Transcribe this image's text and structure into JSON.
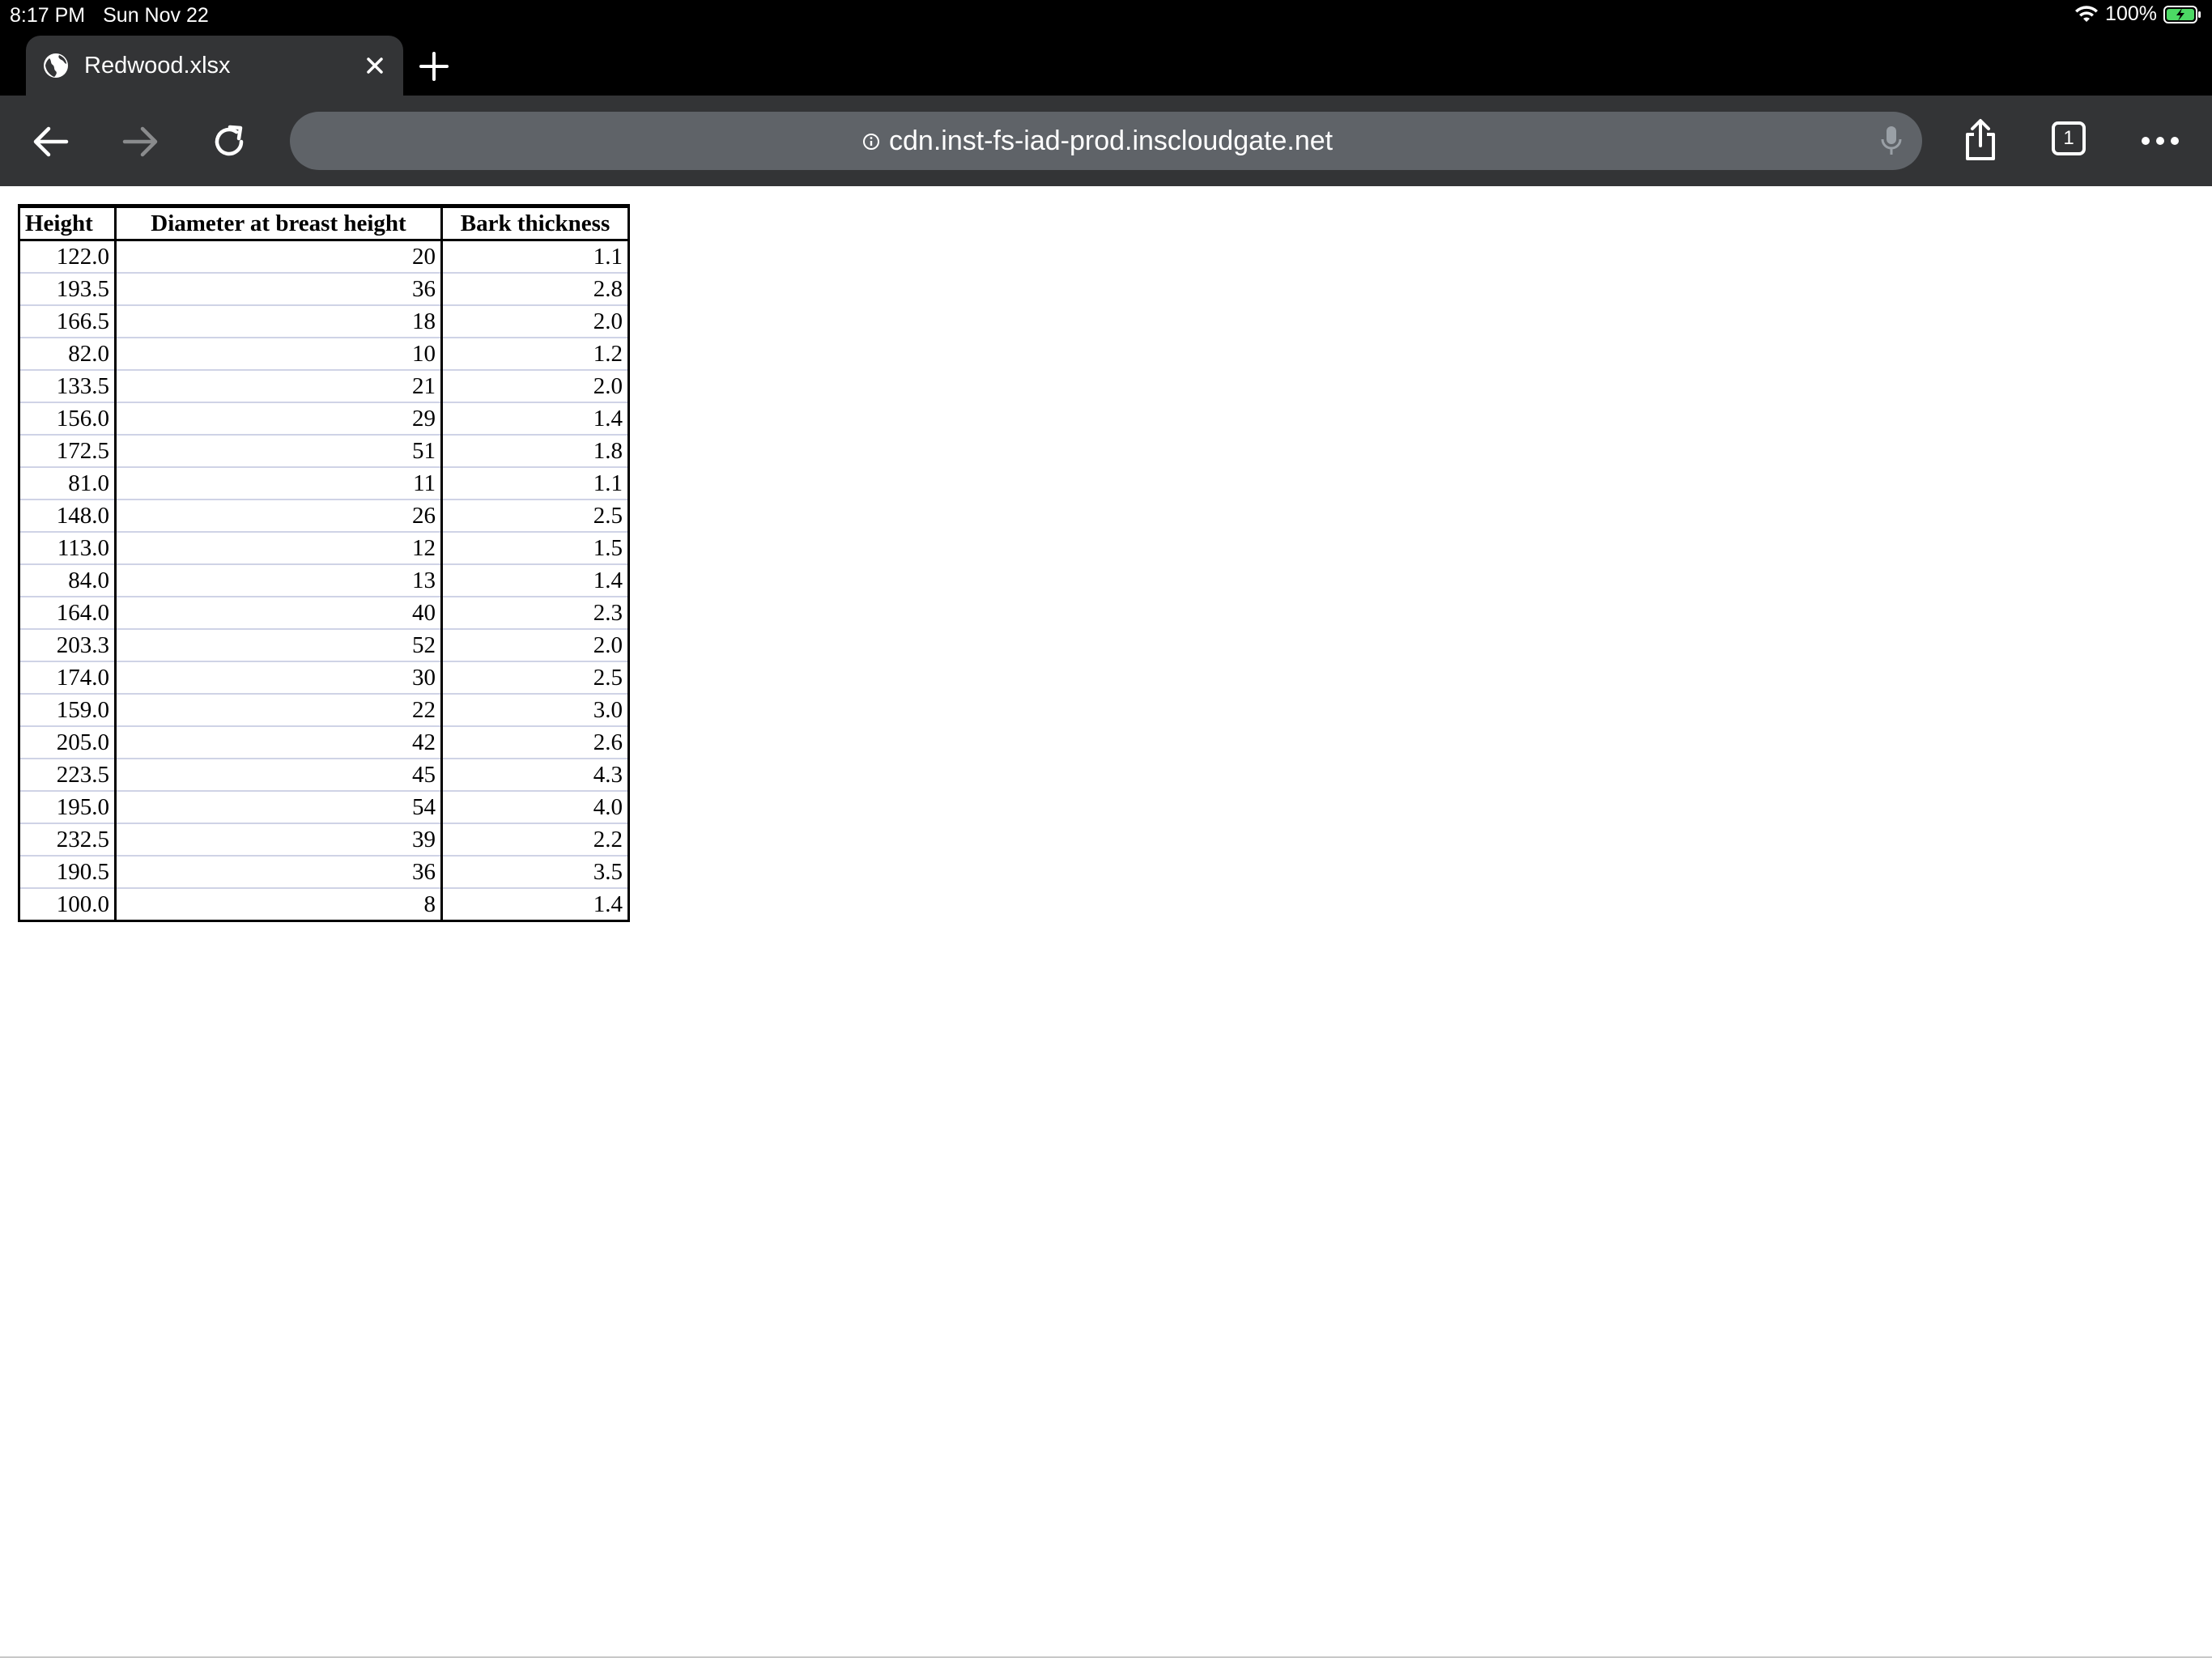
{
  "status_bar": {
    "time": "8:17 PM",
    "date": "Sun Nov 22",
    "battery": "100%",
    "wifi_icon": "wifi-icon",
    "battery_icon": "battery-charging-icon"
  },
  "tab": {
    "title": "Redwood.xlsx",
    "favicon": "globe-icon"
  },
  "toolbar": {
    "url": "cdn.inst-fs-iad-prod.inscloudgate.net",
    "tab_count": "1"
  },
  "table": {
    "headers": [
      "Height",
      "Diameter at breast height",
      "Bark thickness"
    ],
    "rows": [
      [
        "122.0",
        "20",
        "1.1"
      ],
      [
        "193.5",
        "36",
        "2.8"
      ],
      [
        "166.5",
        "18",
        "2.0"
      ],
      [
        "82.0",
        "10",
        "1.2"
      ],
      [
        "133.5",
        "21",
        "2.0"
      ],
      [
        "156.0",
        "29",
        "1.4"
      ],
      [
        "172.5",
        "51",
        "1.8"
      ],
      [
        "81.0",
        "11",
        "1.1"
      ],
      [
        "148.0",
        "26",
        "2.5"
      ],
      [
        "113.0",
        "12",
        "1.5"
      ],
      [
        "84.0",
        "13",
        "1.4"
      ],
      [
        "164.0",
        "40",
        "2.3"
      ],
      [
        "203.3",
        "52",
        "2.0"
      ],
      [
        "174.0",
        "30",
        "2.5"
      ],
      [
        "159.0",
        "22",
        "3.0"
      ],
      [
        "205.0",
        "42",
        "2.6"
      ],
      [
        "223.5",
        "45",
        "4.3"
      ],
      [
        "195.0",
        "54",
        "4.0"
      ],
      [
        "232.5",
        "39",
        "2.2"
      ],
      [
        "190.5",
        "36",
        "3.5"
      ],
      [
        "100.0",
        "8",
        "1.4"
      ]
    ]
  }
}
